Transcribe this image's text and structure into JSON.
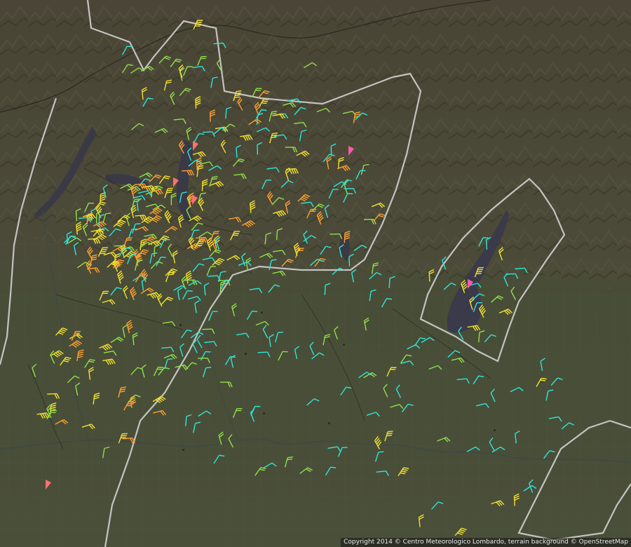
{
  "map": {
    "copyright": "Copyright 2014 © Centro Meteorologico Lombardo, terrain background © OpenStreetMap",
    "colors": {
      "mountains": "#4c4838",
      "plains": "#4a5038",
      "lake": "#3c3c48",
      "region_outline": "#d9d9d9",
      "calm": "#2ee6d8",
      "light": "#8fe04a",
      "moderate": "#f0e030",
      "fresh": "#ffa030",
      "strong": "#ff7070",
      "gale": "#ff5ab0"
    }
  }
}
